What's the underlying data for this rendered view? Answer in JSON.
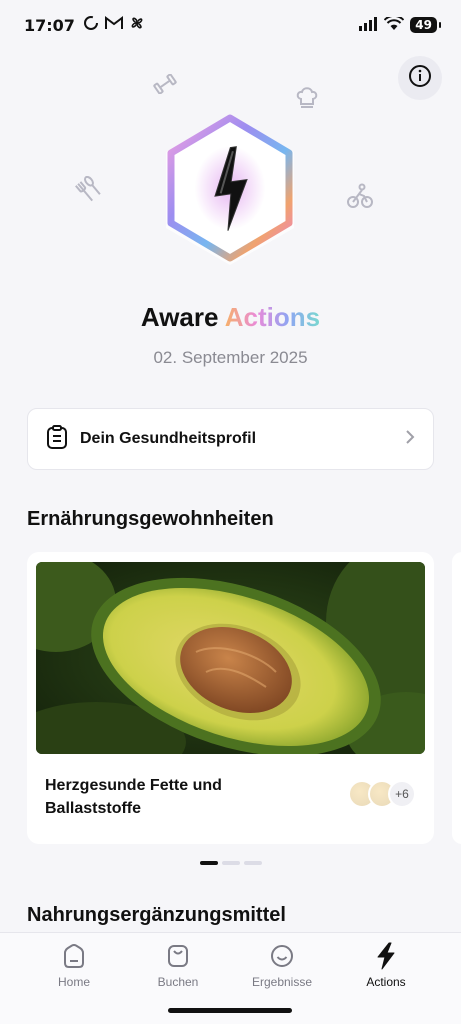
{
  "status_bar": {
    "time": "17:07",
    "left_icons": [
      "loading-ring-icon",
      "gmail-icon",
      "fan-icon"
    ],
    "battery": "49"
  },
  "hero": {
    "decorative_icons": [
      "dumbbell-icon",
      "chef-hat-icon",
      "fork-spoon-icon",
      "cyclist-icon"
    ]
  },
  "title": {
    "prefix": "Aware ",
    "accent": "Actions"
  },
  "date": "02. September 2025",
  "profile_card": {
    "label": "Dein Gesundheitsprofil"
  },
  "sections": {
    "nutrition_title": "Ernährungsgewohnheiten",
    "supplements_title": "Nahrungsergänzungsmittel"
  },
  "carousel": {
    "cards": [
      {
        "title": "Herzgesunde Fette und Ballaststoffe",
        "more_count": "+6"
      }
    ],
    "page_count": 3,
    "active_page": 0
  },
  "tabs": [
    {
      "label": "Home",
      "icon": "home-icon"
    },
    {
      "label": "Buchen",
      "icon": "bag-icon"
    },
    {
      "label": "Ergebnisse",
      "icon": "smiley-icon"
    },
    {
      "label": "Actions",
      "icon": "lightning-icon",
      "active": true
    }
  ],
  "colors": {
    "accent_gradient": [
      "#f6b06a",
      "#e98ad9",
      "#8fa5f2",
      "#79d8d0"
    ],
    "background": "#f6f6f9"
  }
}
